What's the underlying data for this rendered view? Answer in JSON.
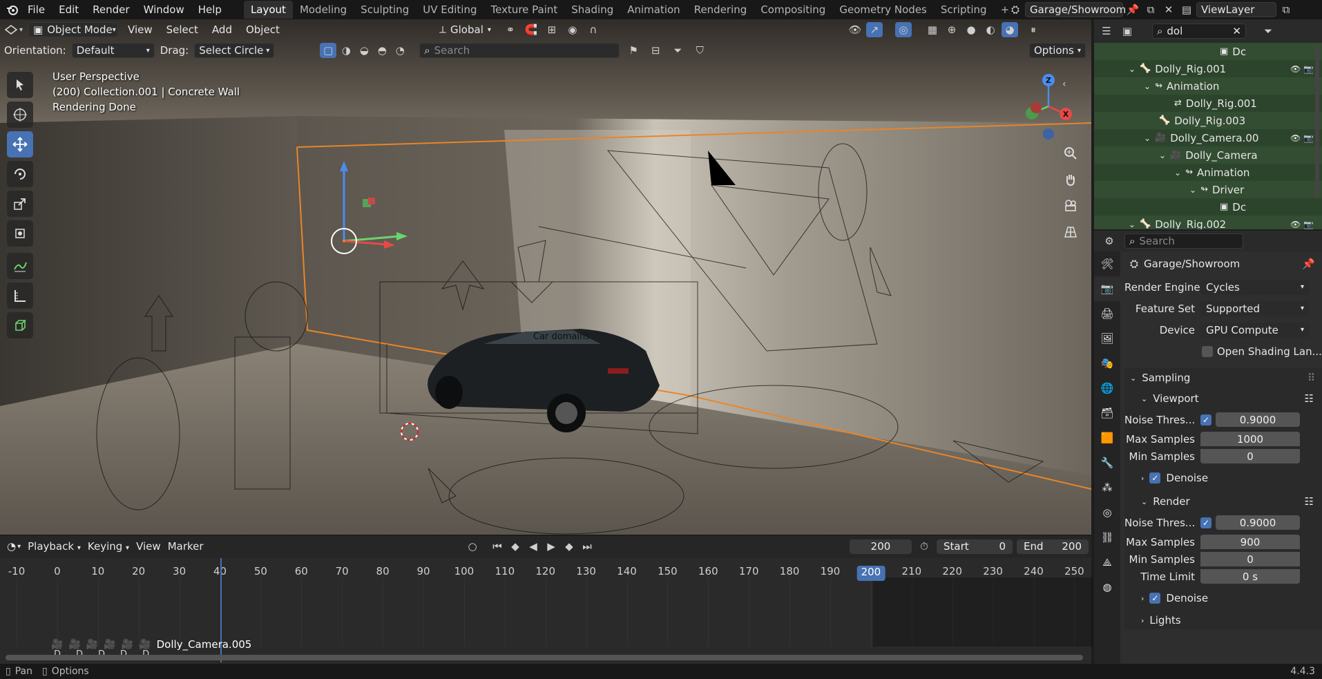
{
  "menu": [
    "File",
    "Edit",
    "Render",
    "Window",
    "Help"
  ],
  "workspaces": [
    "Layout",
    "Modeling",
    "Sculpting",
    "UV Editing",
    "Texture Paint",
    "Shading",
    "Animation",
    "Rendering",
    "Compositing",
    "Geometry Nodes",
    "Scripting"
  ],
  "active_workspace": "Layout",
  "add_workspace": "+",
  "scene_name": "Garage/Showroom",
  "view_layer": "ViewLayer",
  "viewport_header": {
    "mode": "Object Mode",
    "menus": [
      "View",
      "Select",
      "Add",
      "Object"
    ],
    "transform_orientation": "Global",
    "orientation_label": "Orientation:",
    "orientation_value": "Default",
    "drag_label": "Drag:",
    "drag_value": "Select Circle",
    "search_placeholder": "Search",
    "options": "Options"
  },
  "viewport_overlay": {
    "line1": "User Perspective",
    "line2": "(200) Collection.001 | Concrete Wall",
    "line3": "Rendering Done",
    "car_label": "Car domains"
  },
  "gizmo": {
    "z": "Z",
    "x": "X"
  },
  "outliner": {
    "search_value": "dol",
    "rows": [
      {
        "label": "Dc",
        "indent": 8
      },
      {
        "label": "Dolly_Rig.001",
        "indent": 2
      },
      {
        "label": "Animation",
        "indent": 3
      },
      {
        "label": "Dolly_Rig.001",
        "indent": 5
      },
      {
        "label": "Dolly_Rig.003",
        "indent": 4
      },
      {
        "label": "Dolly_Camera.00",
        "indent": 3
      },
      {
        "label": "Dolly_Camera",
        "indent": 4
      },
      {
        "label": "Animation",
        "indent": 5
      },
      {
        "label": "Driver",
        "indent": 6
      },
      {
        "label": "Dc",
        "indent": 8
      },
      {
        "label": "Dolly_Rig.002",
        "indent": 2
      }
    ]
  },
  "properties": {
    "search_placeholder": "Search",
    "context": "Garage/Showroom",
    "render_engine_label": "Render Engine",
    "render_engine": "Cycles",
    "feature_set_label": "Feature Set",
    "feature_set": "Supported",
    "device_label": "Device",
    "device": "GPU Compute",
    "open_shading": "Open Shading Lan...",
    "sampling": "Sampling",
    "viewport": "Viewport",
    "noise_label": "Noise Thres...",
    "vp_noise": "0.9000",
    "max_samples_label": "Max Samples",
    "vp_max": "1000",
    "min_samples_label": "Min Samples",
    "vp_min": "0",
    "denoise": "Denoise",
    "render": "Render",
    "r_noise": "0.9000",
    "r_max": "900",
    "r_min": "0",
    "time_limit_label": "Time Limit",
    "time_limit": "0 s",
    "lights": "Lights",
    "version": "4.4.3"
  },
  "timeline": {
    "menus": [
      "Playback",
      "Keying",
      "View",
      "Marker"
    ],
    "current_frame": "200",
    "start_label": "Start",
    "start": "0",
    "end_label": "End",
    "end": "200",
    "ticks": [
      "-10",
      "0",
      "10",
      "20",
      "30",
      "40",
      "50",
      "60",
      "70",
      "80",
      "90",
      "100",
      "110",
      "120",
      "130",
      "140",
      "150",
      "160",
      "170",
      "180",
      "190",
      "200",
      "210",
      "220",
      "230",
      "240",
      "250"
    ],
    "playhead_frame": "200",
    "marker_label": "Dolly_Camera.005",
    "marker_letter": "D"
  },
  "status": {
    "pan": "Pan",
    "options": "Options"
  },
  "colors": {
    "accent": "#4772b3",
    "selection": "#e8852a",
    "outliner_sel": "#334d33"
  }
}
